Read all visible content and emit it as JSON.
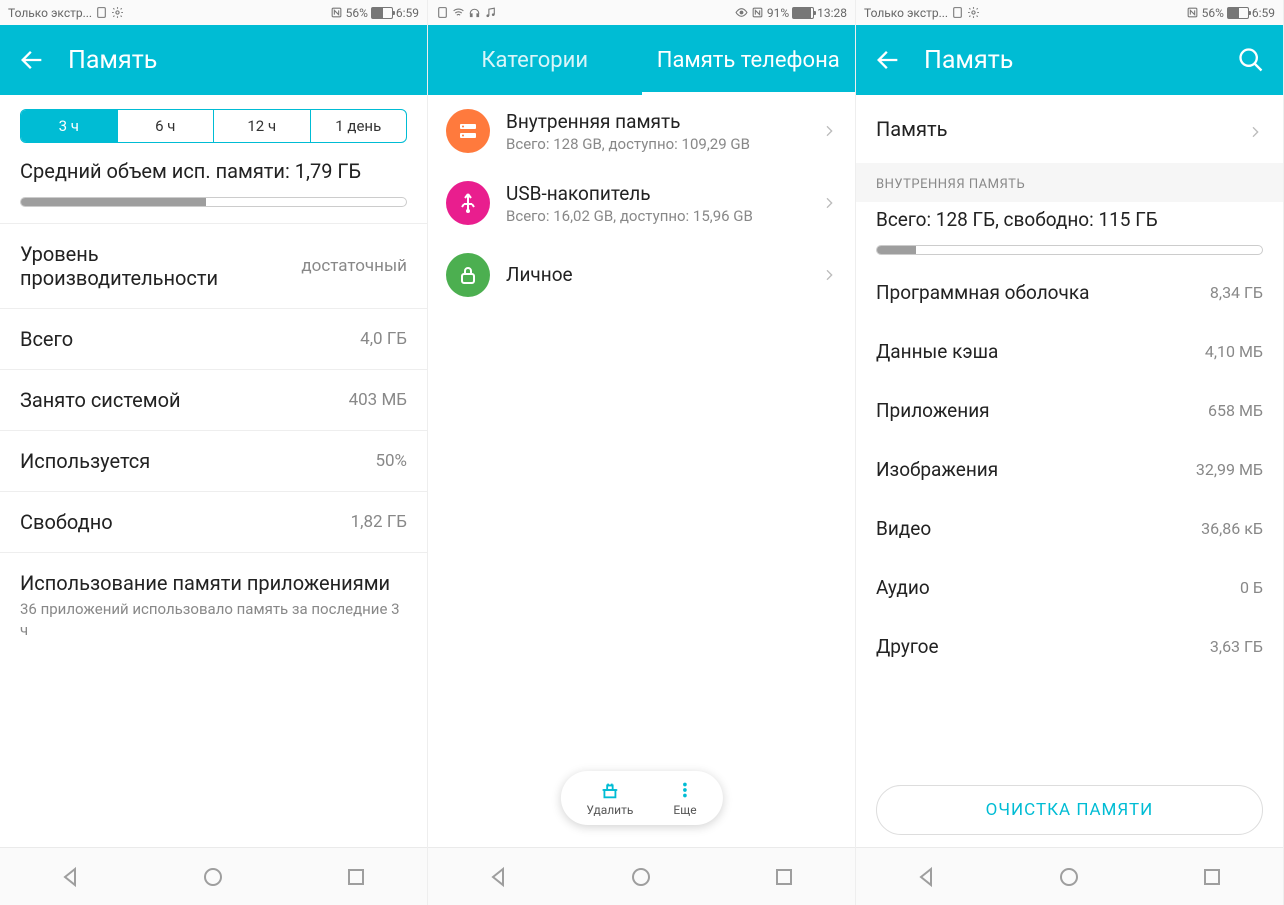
{
  "p1": {
    "status": {
      "l1": "Только экстр...",
      "pct": "56%",
      "time": "6:59"
    },
    "title": "Память",
    "seg": [
      "3 ч",
      "6 ч",
      "12 ч",
      "1 день"
    ],
    "avg": "Средний объем исп. памяти: 1,79 ГБ",
    "bar_pct": 48,
    "rows": [
      {
        "l": "Уровень производительности",
        "v": "достаточный"
      },
      {
        "l": "Всего",
        "v": "4,0 ГБ"
      },
      {
        "l": "Занято системой",
        "v": "403 МБ"
      },
      {
        "l": "Используется",
        "v": "50%"
      },
      {
        "l": "Свободно",
        "v": "1,82 ГБ"
      }
    ],
    "apps": {
      "t": "Использование памяти приложениями",
      "s": "36 приложений использовало память за последние 3 ч"
    }
  },
  "p2": {
    "status": {
      "pct": "91%",
      "time": "13:28"
    },
    "tabs": [
      "Категории",
      "Память телефона"
    ],
    "items": [
      {
        "t": "Внутренняя память",
        "s": "Всего: 128 GB, доступно: 109,29 GB",
        "c": "#ff7a3d",
        "icon": "disk"
      },
      {
        "t": "USB-накопитель",
        "s": "Всего: 16,02 GB, доступно: 15,96 GB",
        "c": "#e91e8e",
        "icon": "usb"
      },
      {
        "t": "Личное",
        "s": "",
        "c": "#4caf50",
        "icon": "lock"
      }
    ],
    "pill": {
      "a": "Удалить",
      "b": "Еще"
    }
  },
  "p3": {
    "status": {
      "l1": "Только экстр...",
      "pct": "56%",
      "time": "6:59"
    },
    "title": "Память",
    "link": "Память",
    "section": "ВНУТРЕННЯЯ ПАМЯТЬ",
    "summary": "Всего: 128 ГБ, свободно: 115 ГБ",
    "bar_pct": 10,
    "rows": [
      {
        "l": "Программная оболочка",
        "v": "8,34 ГБ"
      },
      {
        "l": "Данные кэша",
        "v": "4,10 МБ"
      },
      {
        "l": "Приложения",
        "v": "658 МБ"
      },
      {
        "l": "Изображения",
        "v": "32,99 МБ"
      },
      {
        "l": "Видео",
        "v": "36,86 кБ"
      },
      {
        "l": "Аудио",
        "v": "0 Б"
      },
      {
        "l": "Другое",
        "v": "3,63 ГБ"
      }
    ],
    "clean": "ОЧИСТКА ПАМЯТИ"
  }
}
